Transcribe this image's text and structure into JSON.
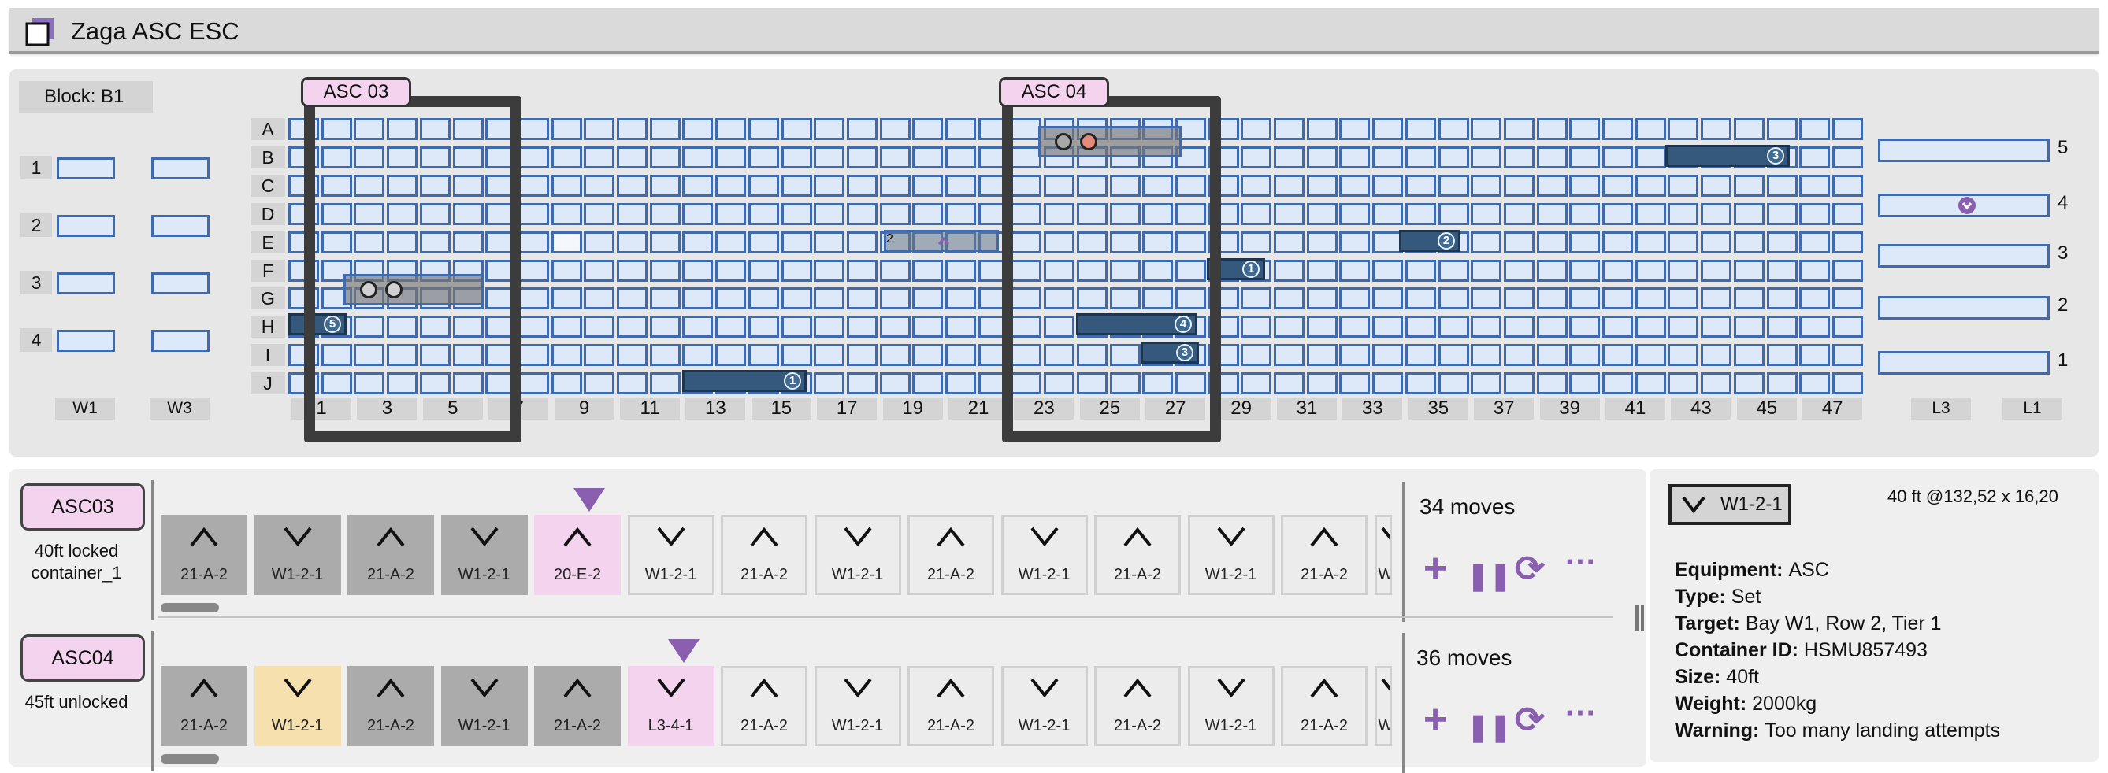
{
  "app": {
    "title": "Zaga ASC ESC"
  },
  "yard": {
    "block_label": "Block: B1",
    "row_labels": [
      "A",
      "B",
      "C",
      "D",
      "E",
      "F",
      "G",
      "H",
      "I",
      "J"
    ],
    "bay_labels": [
      "1",
      "3",
      "5",
      "7",
      "9",
      "11",
      "13",
      "15",
      "17",
      "19",
      "21",
      "23",
      "25",
      "27",
      "29",
      "31",
      "33",
      "35",
      "37",
      "39",
      "41",
      "43",
      "45",
      "47"
    ],
    "waterside": {
      "tiers": [
        "1",
        "2",
        "3",
        "4"
      ],
      "lanes": [
        "W1",
        "W3"
      ]
    },
    "landside": {
      "tiers": [
        "5",
        "4",
        "3",
        "2",
        "1"
      ],
      "lanes": [
        "L3",
        "L1"
      ]
    },
    "containers": [
      {
        "badge": "5"
      },
      {
        "badge": "1"
      },
      {
        "badge": "2"
      },
      {
        "badge": "1"
      },
      {
        "badge": "4"
      },
      {
        "badge": "3"
      },
      {
        "badge": "2"
      },
      {
        "badge": "3"
      }
    ],
    "cranes": [
      {
        "name": "ASC 03"
      },
      {
        "name": "ASC 04"
      }
    ]
  },
  "lanes": [
    {
      "equipment": "ASC03",
      "description": "40ft locked container_1",
      "moves": "34 moves",
      "tasks": [
        {
          "dir": "up",
          "label": "21-A-2",
          "state": "done"
        },
        {
          "dir": "down",
          "label": "W1-2-1",
          "state": "done"
        },
        {
          "dir": "up",
          "label": "21-A-2",
          "state": "done"
        },
        {
          "dir": "down",
          "label": "W1-2-1",
          "state": "done"
        },
        {
          "dir": "up",
          "label": "20-E-2",
          "state": "active"
        },
        {
          "dir": "down",
          "label": "W1-2-1",
          "state": "pending"
        },
        {
          "dir": "up",
          "label": "21-A-2",
          "state": "pending"
        },
        {
          "dir": "down",
          "label": "W1-2-1",
          "state": "pending"
        },
        {
          "dir": "up",
          "label": "21-A-2",
          "state": "pending"
        },
        {
          "dir": "down",
          "label": "W1-2-1",
          "state": "pending"
        },
        {
          "dir": "up",
          "label": "21-A-2",
          "state": "pending"
        },
        {
          "dir": "down",
          "label": "W1-2-1",
          "state": "pending"
        },
        {
          "dir": "up",
          "label": "21-A-2",
          "state": "pending"
        },
        {
          "dir": "down",
          "label": "W",
          "state": "pending"
        }
      ]
    },
    {
      "equipment": "ASC04",
      "description": "45ft unlocked",
      "moves": "36 moves",
      "tasks": [
        {
          "dir": "up",
          "label": "21-A-2",
          "state": "done"
        },
        {
          "dir": "down",
          "label": "W1-2-1",
          "state": "warn"
        },
        {
          "dir": "up",
          "label": "21-A-2",
          "state": "done"
        },
        {
          "dir": "down",
          "label": "W1-2-1",
          "state": "done"
        },
        {
          "dir": "up",
          "label": "21-A-2",
          "state": "done"
        },
        {
          "dir": "down",
          "label": "L3-4-1",
          "state": "active"
        },
        {
          "dir": "up",
          "label": "21-A-2",
          "state": "pending"
        },
        {
          "dir": "down",
          "label": "W1-2-1",
          "state": "pending"
        },
        {
          "dir": "up",
          "label": "21-A-2",
          "state": "pending"
        },
        {
          "dir": "down",
          "label": "W1-2-1",
          "state": "pending"
        },
        {
          "dir": "up",
          "label": "21-A-2",
          "state": "pending"
        },
        {
          "dir": "down",
          "label": "W1-2-1",
          "state": "pending"
        },
        {
          "dir": "up",
          "label": "21-A-2",
          "state": "pending"
        },
        {
          "dir": "down",
          "label": "W",
          "state": "pending"
        }
      ]
    }
  ],
  "controls": {
    "add": "+",
    "pause": "❚❚",
    "refresh": "⟳",
    "more": "···"
  },
  "details": {
    "selected_task": "W1-2-1",
    "selected_dir": "down",
    "position": "40 ft @132,52 x 16,20",
    "fields": [
      {
        "key": "Equipment",
        "value": "ASC"
      },
      {
        "key": "Type",
        "value": "Set"
      },
      {
        "key": "Target",
        "value": "Bay W1, Row 2, Tier 1"
      },
      {
        "key": "Container ID",
        "value": "HSMU857493"
      },
      {
        "key": "Size",
        "value": "40ft"
      },
      {
        "key": "Weight",
        "value": "2000kg"
      },
      {
        "key": "Warning",
        "value": "Too many landing attempts"
      }
    ]
  },
  "colors": {
    "accent": "#8b5fb0",
    "slot_border": "#3e6ab0",
    "slot_fill": "#dde8f8",
    "container": "#35597d",
    "crane_tag": "#f4d3ee"
  },
  "icons": [
    "app-window-icon",
    "up-chevron-icon",
    "down-chevron-icon",
    "plus-icon",
    "pause-icon",
    "refresh-icon",
    "more-icon",
    "current-task-pointer-icon"
  ]
}
